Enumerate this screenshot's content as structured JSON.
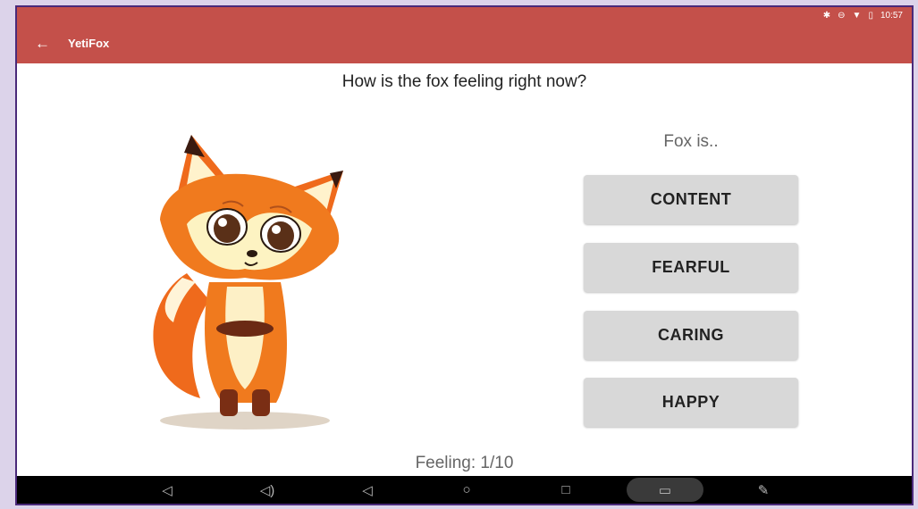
{
  "status_bar": {
    "time": "10:57",
    "icons": [
      "bluetooth-icon",
      "do-not-disturb-icon",
      "wifi-icon",
      "battery-icon"
    ]
  },
  "appbar": {
    "title": "YetiFox",
    "back_icon": "arrow-left-icon",
    "color": "#c4504a"
  },
  "question": "How is the fox feeling right now?",
  "prompt": "Fox is..",
  "options": [
    "CONTENT",
    "FEARFUL",
    "CARING",
    "HAPPY"
  ],
  "progress": "Feeling: 1/10",
  "nav_bar": {
    "items": [
      "volume-down-icon",
      "volume-up-icon",
      "back-triangle-icon",
      "home-circle-icon",
      "recents-square-icon",
      "screenshot-icon",
      "pen-icon"
    ]
  }
}
